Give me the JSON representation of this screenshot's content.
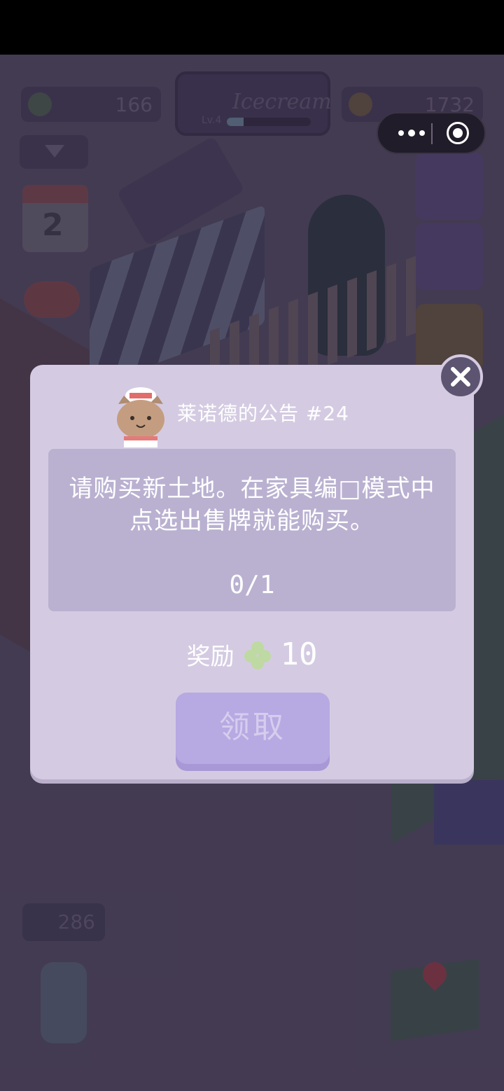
{
  "hud": {
    "clover_count": "166",
    "coin_count": "1732",
    "shop_name": "Icecream",
    "shop_level": "Lv.4",
    "shop_level_progress": 0.2,
    "calendar_day": "2",
    "jar_count": "286"
  },
  "capsule": {
    "more": "more-menu",
    "close": "close-miniprogram"
  },
  "dialog": {
    "title": "莱诺德的公告 #24",
    "message": "请购买新土地。在家具编□模式中点选出售牌就能购买。",
    "progress": "0/1",
    "reward_label": "奖励",
    "reward_amount": "10",
    "claim_label": "领取"
  },
  "colors": {
    "dialog_bg": "#d4cbe2",
    "panel_bg": "#bab1d1",
    "claim_button": "#b7a9e2",
    "clover": "#bfd9a2"
  }
}
